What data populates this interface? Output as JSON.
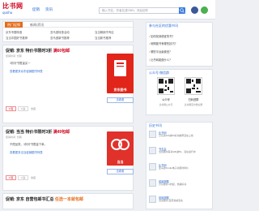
{
  "header": {
    "logo_cn": "比书网",
    "logo_en": "qushu",
    "nav": [
      "促销",
      "资讯"
    ],
    "search_placeholder": "输入书名，作者名或ISBN，然后回车"
  },
  "categories": {
    "tabs": [
      "热门促销",
      "新闻/资讯"
    ],
    "items": [
      "京东专题特惠",
      "亚马逊特惠活动",
      "当当畅销书专区",
      "当当中国好书推荐",
      "亚马逊新书推荐",
      "当当新书推荐",
      "京东新书推荐",
      "当当促销活动汇总"
    ]
  },
  "posts": [
    {
      "title_prefix": "促销: 京东 特价书限时3折 ",
      "title_hl": "满60包邮",
      "meta": "促销时间: 长期",
      "text": "3折好书限量买一",
      "link": "查看更多京东促销图书列表",
      "img_caption": "京东图书",
      "like": "0 赞",
      "dislike": "0 踩",
      "add_list": "收藏",
      "cart": "去看看"
    },
    {
      "title_prefix": "促销: 当当 特价书限时3折 ",
      "title_hl": "满49包邮",
      "meta": "促销时间: 长期",
      "text": "不限品类，3折好书限量下单。",
      "link": "查看更多当当促销图书列表",
      "img_caption": "当当",
      "like": "0 赞",
      "dislike": "0 踩",
      "add_list": "收藏",
      "cart": "去看看"
    },
    {
      "title_prefix": "促销: 京东 自营包邮书汇总 ",
      "title_hl": "任选一本就包邮"
    }
  ],
  "sidebar": {
    "qa_title": "参与社区的优惠书讯",
    "questions": [
      "如何找到便宜的书？",
      "网购图书有哪些技巧？",
      "哪些平台最便宜？",
      "比书网能做什么？"
    ],
    "follow_title": "公众号  微信群",
    "qr_labels": [
      "公众号",
      "扫码进群"
    ],
    "qr_subs": [
      "比书网公众号",
      "比书网官方微信群"
    ],
    "history_title": "历史书讯",
    "history": [
      {
        "name": "比书网",
        "text": "京东满100减50好书推荐活动上线"
      },
      {
        "name": "书友会",
        "text": "当当图书每满100减50，活动进行中"
      },
      {
        "name": "比书网",
        "text": "亚马逊Kindle电子书限时特价"
      },
      {
        "name": "促销提醒",
        "text": "京东图书 2折起，热销好书"
      },
      {
        "name": "促销提醒",
        "text": "当当图书 自营满减活动"
      }
    ]
  },
  "colors": {
    "accent": "#e46b19",
    "link": "#2a6bd1",
    "brand_red": "#d0021b",
    "jd_red": "#e1251b",
    "dangdang_red": "#e0312b"
  }
}
